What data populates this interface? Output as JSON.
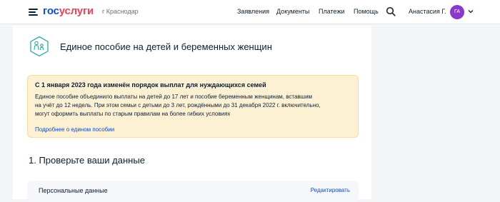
{
  "header": {
    "logo_part1": "гос",
    "logo_part2": "услуги",
    "city": "г Краснодар",
    "nav": [
      "Заявления",
      "Документы",
      "Платежи",
      "Помощь"
    ],
    "user_name": "Анастасия Г.",
    "avatar_initials": "ГА"
  },
  "service": {
    "icon": "family-icon",
    "title": "Единое пособие на детей и беременных женщин"
  },
  "notice": {
    "title": "С 1 января 2023 года изменён порядок выплат для нуждающихся семей",
    "lines": [
      "Единое пособие объединило выплаты на детей до 17 лет и пособие беременным женщинам, вставшим",
      "на учёт до 12 недель. При этом семьи с детьми до 3 лет, рождёнными до 31 декабря 2022 г. включительно,",
      "могут оформить выплаты по старым правилам на более гибких условиях"
    ],
    "link": "Подробнее о едином пособии"
  },
  "section": {
    "title": "1. Проверьте ваши данные"
  },
  "personal": {
    "title": "Персональные данные",
    "edit_link": "Редактировать"
  },
  "colors": {
    "brand_blue": "#0d4cd3",
    "brand_red": "#ee3f58",
    "avatar": "#8a39c9",
    "notice_bg": "#fdf1d3",
    "icon_teal": "#2ea8a0"
  }
}
